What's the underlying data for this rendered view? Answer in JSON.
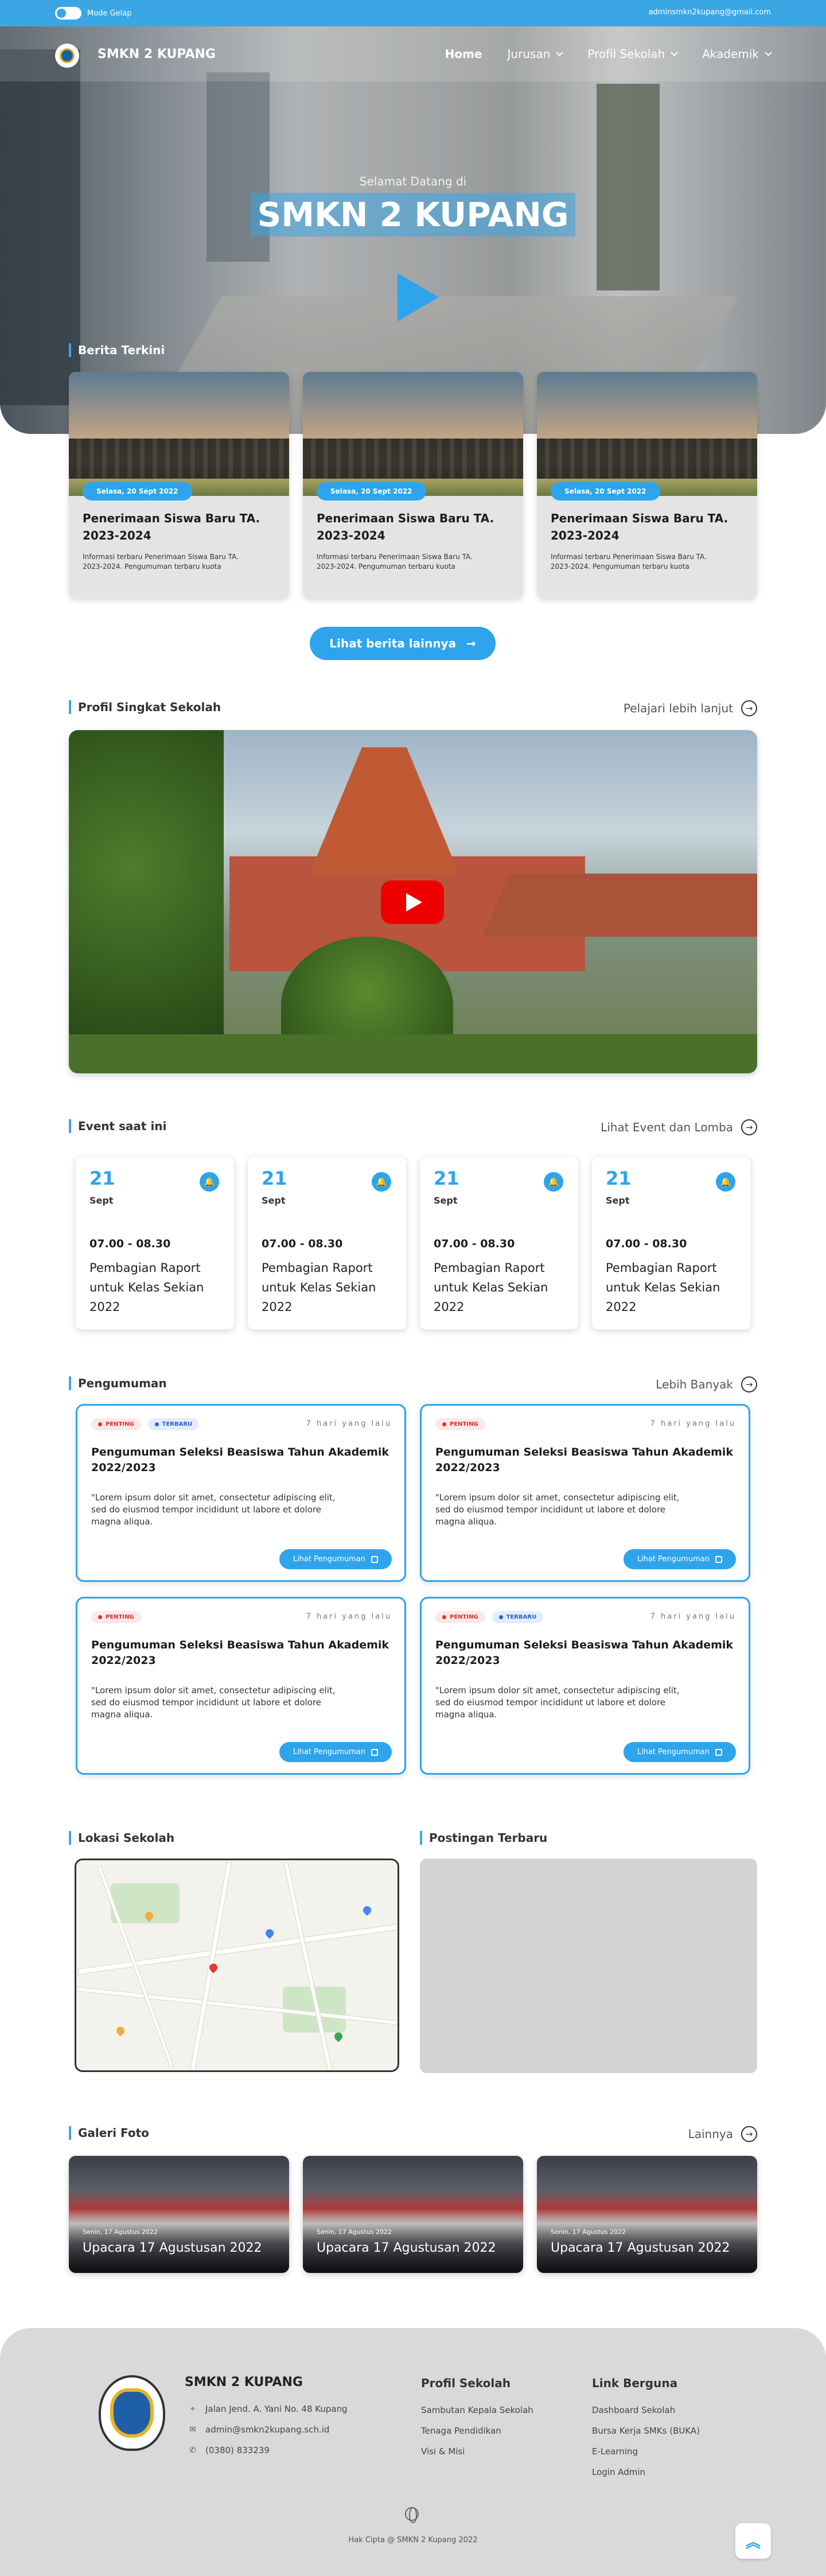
{
  "topbar": {
    "mode_label": "Mode Gelap",
    "email": "adminsmkn2kupang@gmail.com"
  },
  "nav": {
    "brand": "SMKN 2 KUPANG",
    "items": [
      {
        "label": "Home",
        "has_dropdown": false,
        "active": true
      },
      {
        "label": "Jurusan",
        "has_dropdown": true
      },
      {
        "label": "Profil Sekolah",
        "has_dropdown": true
      },
      {
        "label": "Akademik",
        "has_dropdown": true
      }
    ]
  },
  "hero": {
    "welcome": "Selamat Datang di",
    "title": "SMKN 2 KUPANG"
  },
  "news": {
    "section_title": "Berita Terkini",
    "items": [
      {
        "date": "Selasa, 20 Sept 2022",
        "title": "Penerimaan Siswa Baru TA. 2023-2024",
        "desc": "Informasi terbaru Penerimaan Siswa Baru TA. 2023-2024. Pengumuman terbaru kuota"
      },
      {
        "date": "Selasa, 20 Sept 2022",
        "title": "Penerimaan Siswa Baru TA. 2023-2024",
        "desc": "Informasi terbaru Penerimaan Siswa Baru TA. 2023-2024. Pengumuman terbaru kuota"
      },
      {
        "date": "Selasa, 20 Sept 2022",
        "title": "Penerimaan Siswa Baru TA. 2023-2024",
        "desc": "Informasi terbaru Penerimaan Siswa Baru TA. 2023-2024. Pengumuman terbaru kuota"
      }
    ],
    "more_button": "Lihat berita lainnya"
  },
  "profile": {
    "section_title": "Profil Singkat Sekolah",
    "link": "Pelajari lebih lanjut"
  },
  "events": {
    "section_title": "Event saat ini",
    "link": "Lihat Event dan Lomba",
    "items": [
      {
        "day": "21",
        "month": "Sept",
        "time": "07.00 - 08.30",
        "title": "Pembagian Raport untuk Kelas Sekian 2022"
      },
      {
        "day": "21",
        "month": "Sept",
        "time": "07.00 - 08.30",
        "title": "Pembagian Raport untuk Kelas Sekian 2022"
      },
      {
        "day": "21",
        "month": "Sept",
        "time": "07.00 - 08.30",
        "title": "Pembagian Raport untuk Kelas Sekian 2022"
      },
      {
        "day": "21",
        "month": "Sept",
        "time": "07.00 - 08.30",
        "title": "Pembagian Raport untuk Kelas Sekian 2022"
      }
    ]
  },
  "announcements": {
    "section_title": "Pengumuman",
    "link": "Lebih Banyak",
    "tag_important": "PENTING",
    "tag_new": "TERBARU",
    "items": [
      {
        "time": "7 hari yang lalu",
        "title": "Pengumuman Seleksi Beasiswa Tahun Akademik 2022/2023",
        "body": "\"Lorem ipsum dolor sit amet, consectetur adipiscing elit, sed do eiusmod tempor incididunt ut labore et dolore magna aliqua.",
        "button": "Lihat Pengumuman"
      },
      {
        "time": "7 hari yang lalu",
        "title": "Pengumuman Seleksi Beasiswa Tahun Akademik 2022/2023",
        "body": "\"Lorem ipsum dolor sit amet, consectetur adipiscing elit, sed do eiusmod tempor incididunt ut labore et dolore magna aliqua.",
        "button": "Lihat Pengumuman"
      },
      {
        "time": "7 hari yang lalu",
        "title": "Pengumuman Seleksi Beasiswa Tahun Akademik 2022/2023",
        "body": "\"Lorem ipsum dolor sit amet, consectetur adipiscing elit, sed do eiusmod tempor incididunt ut labore et dolore magna aliqua.",
        "button": "Lihat Pengumuman"
      },
      {
        "time": "7 hari yang lalu",
        "title": "Pengumuman Seleksi Beasiswa Tahun Akademik 2022/2023",
        "body": "\"Lorem ipsum dolor sit amet, consectetur adipiscing elit, sed do eiusmod tempor incididunt ut labore et dolore magna aliqua.",
        "button": "Lihat Pengumuman"
      }
    ]
  },
  "location": {
    "section_title": "Lokasi Sekolah"
  },
  "posts": {
    "section_title": "Postingan Terbaru"
  },
  "gallery": {
    "section_title": "Galeri Foto",
    "link": "Lainnya",
    "items": [
      {
        "date": "Senin, 17 Agustus 2022",
        "title": "Upacara 17 Agustusan 2022"
      },
      {
        "date": "Senin, 17 Agustus 2022",
        "title": "Upacara 17 Agustusan 2022"
      },
      {
        "date": "Senin, 17 Agustus 2022",
        "title": "Upacara 17 Agustusan 2022"
      }
    ]
  },
  "footer": {
    "name": "SMKN 2 KUPANG",
    "address": "Jalan Jend. A. Yani No. 48 Kupang",
    "email": "admin@smkn2kupang.sch.id",
    "phone": "(0380) 833239",
    "profile_title": "Profil Sekolah",
    "profile_links": [
      "Sambutan Kepala Sekolah",
      "Tenaga Pendidikan",
      "Visi & Misi"
    ],
    "links_title": "Link Berguna",
    "useful_links": [
      "Dashboard Sekolah",
      "Bursa Kerja SMKs (BUKA)",
      "E-Learning",
      "Login Admin"
    ],
    "copyright": "Hak Cipta @ SMKN 2 Kupang 2022"
  },
  "colors": {
    "accent": "#2ea4ec",
    "topbar": "#3aa6e4",
    "footer_bg": "#d9d9d9",
    "tag_red": "#e03030",
    "tag_blue": "#2d5fc9"
  },
  "icons": {
    "toggle": "toggle-icon",
    "play": "play-icon",
    "youtube": "youtube-play-icon",
    "bell": "bell-icon",
    "arrow": "arrow-right-circle-icon",
    "external": "external-link-icon",
    "pin": "location-pin-icon",
    "mail": "mail-icon",
    "phone": "phone-icon",
    "globe": "globe-icon",
    "top": "chevrons-up-icon"
  }
}
